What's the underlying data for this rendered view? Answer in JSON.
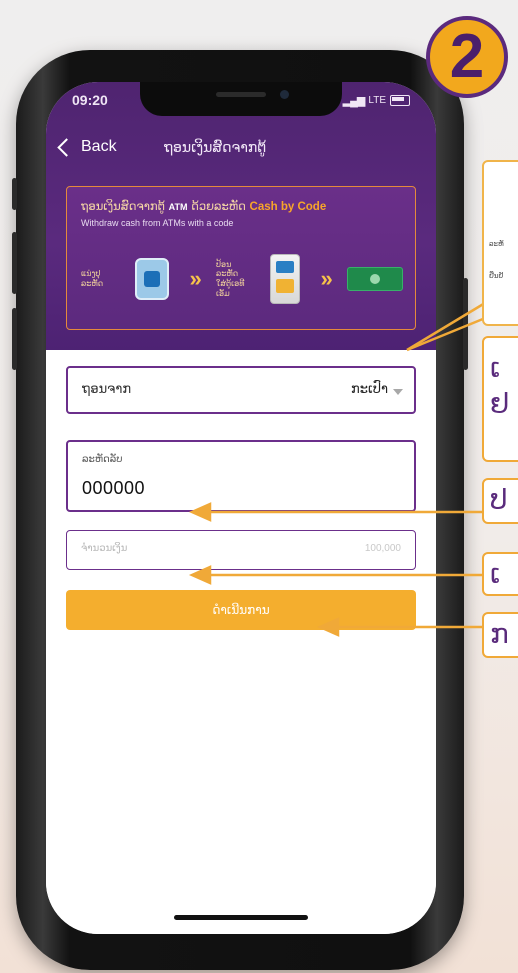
{
  "badge": {
    "number": "2"
  },
  "status_bar": {
    "time": "09:20",
    "network": "LTE"
  },
  "nav": {
    "back_label": "Back",
    "title": "ຖອນເງິນສົດຈາກຕູ້"
  },
  "banner": {
    "title_lao": "ຖອນເງິນສົດຈາກຕູ້",
    "title_atm": "ATM",
    "title_with": "ດ້ວຍລະຫັດ",
    "title_highlight": "Cash by Code",
    "subtitle": "Withdraw cash from ATMs with a code",
    "step1": "ແນ່ງປຸ ລະຫັດ",
    "step2": "ປ້ອນລະຫັດ ໃສ່ຕູ້ເອທີເອັມ"
  },
  "form": {
    "from_label": "ຖອນຈາກ",
    "from_value": "ກະເປົາ",
    "code_label": "ລະຫັດລັບ",
    "code_value": "000000",
    "amount_placeholder": "ຈຳນວນເງິນ",
    "amount_limit": "100,000",
    "continue_label": "ດຳເນີນການ"
  },
  "callouts": {
    "popup_line1": "ລະຫັ",
    "popup_line2": "ຢືນຢັ",
    "c1_line1": "ເ",
    "c1_line2": "ຢ",
    "c2": "ປ",
    "c3": "ເ",
    "c4": "ກ"
  },
  "colors": {
    "purple": "#5a2a7e",
    "orange": "#f4ae2e",
    "border_purple": "#6b2f8b"
  }
}
